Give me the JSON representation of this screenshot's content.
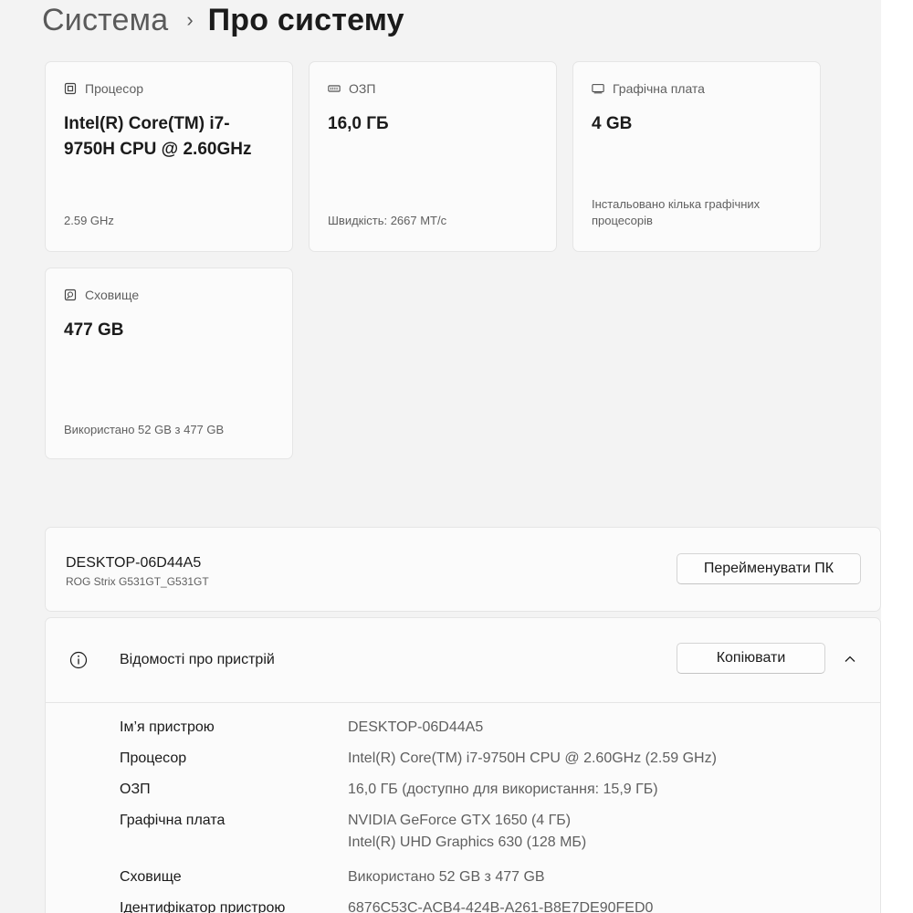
{
  "breadcrumb": {
    "parent": "Система",
    "separator": "›",
    "current": "Про систему"
  },
  "cards": {
    "cpu": {
      "icon": "cpu-icon",
      "label": "Процесор",
      "value": "Intel(R) Core(TM) i7-9750H CPU @ 2.60GHz",
      "sub": "2.59 GHz"
    },
    "ram": {
      "icon": "ram-icon",
      "label": "ОЗП",
      "value": "16,0 ГБ",
      "sub": "Швидкість: 2667 MT/с"
    },
    "gpu": {
      "icon": "gpu-icon",
      "label": "Графічна плата",
      "value": "4 GB",
      "sub": "Інстальовано кілька графічних процесорів"
    },
    "storage": {
      "icon": "storage-icon",
      "label": "Сховище",
      "value": "477 GB",
      "sub": "Використано 52 GB з 477 GB"
    }
  },
  "device": {
    "name": "DESKTOP-06D44A5",
    "model": "ROG Strix G531GT_G531GT",
    "rename_button": "Перейменувати ПК"
  },
  "device_info": {
    "title": "Відомості про пристрій",
    "copy_button": "Копіювати",
    "rows": [
      {
        "label": "Ім’я пристрою",
        "value": "DESKTOP-06D44A5"
      },
      {
        "label": "Процесор",
        "value": "Intel(R) Core(TM) i7-9750H CPU @ 2.60GHz (2.59 GHz)"
      },
      {
        "label": "ОЗП",
        "value": "16,0 ГБ (доступно для використання: 15,9 ГБ)"
      },
      {
        "label": "Графічна плата",
        "value": "NVIDIA GeForce GTX 1650 (4 ГБ)",
        "value2": "Intel(R) UHD Graphics 630 (128 МБ)"
      },
      {
        "label": "Сховище",
        "value": "Використано 52 GB з 477 GB"
      },
      {
        "label": "Ідентифікатор пристрою",
        "value": "6876C53C-ACB4-424B-A261-B8E7DE90FED0"
      }
    ]
  }
}
